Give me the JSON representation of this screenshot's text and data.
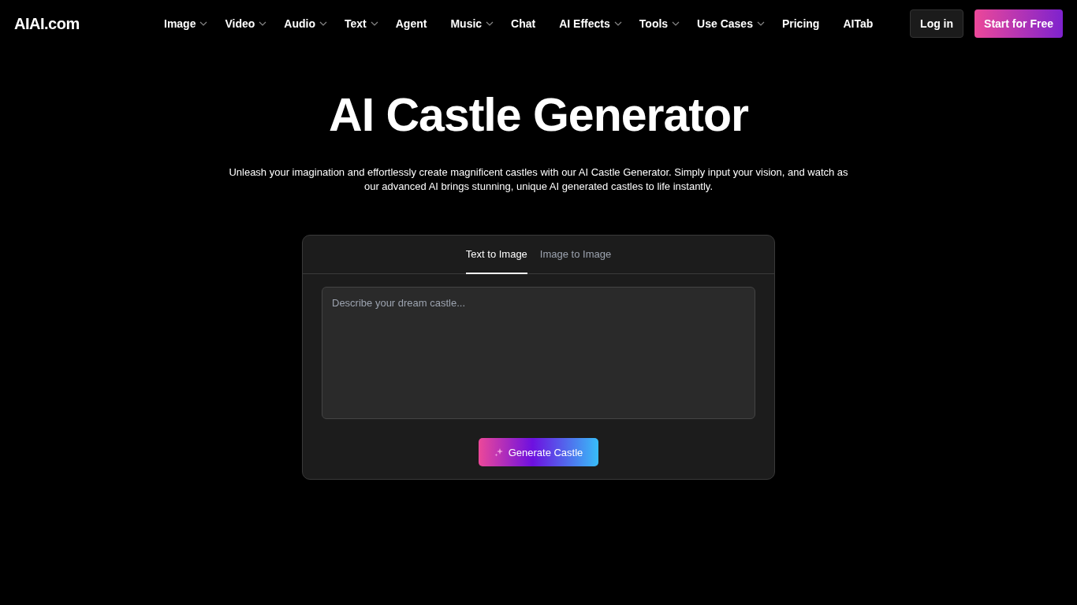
{
  "logo": "AIAI.com",
  "nav": [
    {
      "label": "Image",
      "dropdown": true
    },
    {
      "label": "Video",
      "dropdown": true
    },
    {
      "label": "Audio",
      "dropdown": true
    },
    {
      "label": "Text",
      "dropdown": true
    },
    {
      "label": "Agent",
      "dropdown": false
    },
    {
      "label": "Music",
      "dropdown": true
    },
    {
      "label": "Chat",
      "dropdown": false
    },
    {
      "label": "AI Effects",
      "dropdown": true
    },
    {
      "label": "Tools",
      "dropdown": true
    },
    {
      "label": "Use Cases",
      "dropdown": true
    },
    {
      "label": "Pricing",
      "dropdown": false
    },
    {
      "label": "AITab",
      "dropdown": false
    }
  ],
  "login": "Log in",
  "start": "Start for Free",
  "title": "AI Castle Generator",
  "subtitle": "Unleash your imagination and effortlessly create magnificent castles with our AI Castle Generator. Simply input your vision, and watch as our advanced AI brings stunning, unique AI generated castles to life instantly.",
  "tabs": [
    {
      "label": "Text to Image",
      "selected": true
    },
    {
      "label": "Image to Image",
      "selected": false
    }
  ],
  "prompt": {
    "placeholder": "Describe your dream castle..."
  },
  "generate": "Generate Castle"
}
